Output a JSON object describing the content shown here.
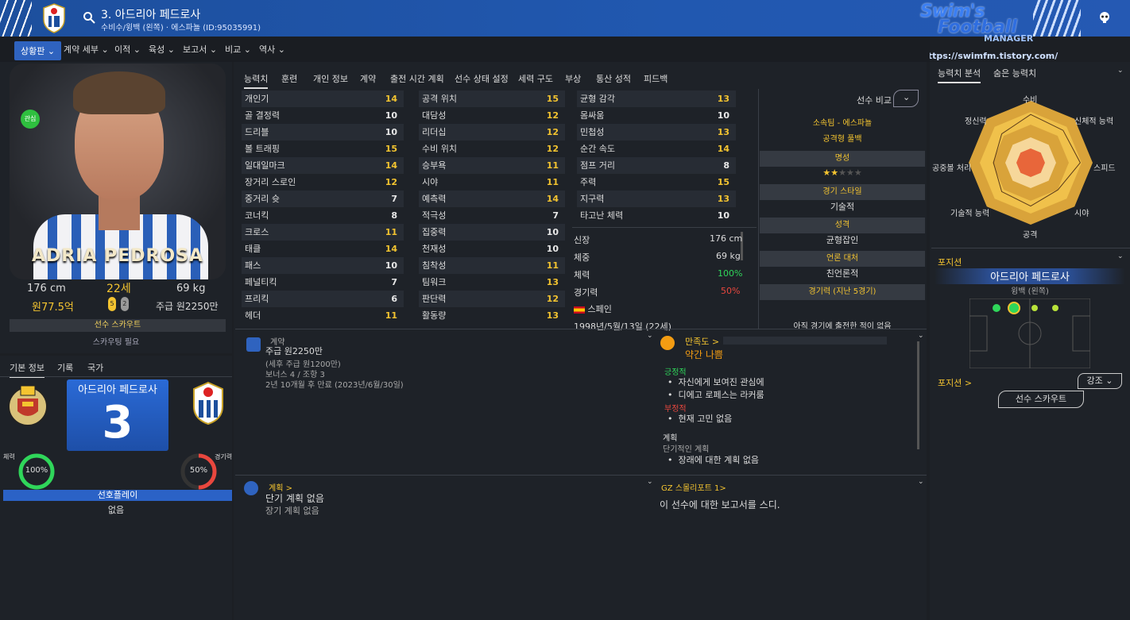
{
  "header": {
    "player_title": "3. 아드리아 페드로사",
    "player_sub": "수비수/윙백 (왼쪽) · 에스파뇰 (ID:95035991)"
  },
  "brand": {
    "line1": "Swim's",
    "line2": "Football",
    "line3": "MANAGER",
    "url": "https://swimfm.tistory.com/"
  },
  "nav": {
    "items": [
      "상황판",
      "계약 세부",
      "이적",
      "육성",
      "보고서",
      "비교",
      "역사"
    ]
  },
  "left": {
    "shirt_name": "ADRIA PEDROSA",
    "ready_badge": "관심",
    "height": "176 cm",
    "age": "22세",
    "weight": "69 kg",
    "value": "원77.5억",
    "foot_left": "5",
    "foot_right": "2",
    "wage": "주급 원2250만",
    "scout_label": "선수 스카우트",
    "scout_need": "스카우팅 필요"
  },
  "left_bottom": {
    "tabs": [
      "기본 정보",
      "기록",
      "국가"
    ],
    "card_name": "아드리아 페드로사",
    "number": "3",
    "fitness_label": "체력",
    "fitness_val": "100%",
    "condition_label": "경기력",
    "condition_val": "50%",
    "pref_label": "선호플레이",
    "pref_val": "없음"
  },
  "mid": {
    "tabs": [
      "능력치",
      "훈련",
      "개인 정보",
      "계약",
      "출전 시간 계획",
      "선수 상태 설정",
      "세력 구도",
      "부상",
      "통산 성적",
      "피드백"
    ],
    "col1": [
      [
        "개인기",
        "14"
      ],
      [
        "골 결정력",
        "10"
      ],
      [
        "드리블",
        "10"
      ],
      [
        "볼 트래핑",
        "15"
      ],
      [
        "일대일마크",
        "14"
      ],
      [
        "장거리 스로인",
        "12"
      ],
      [
        "중거리 슛",
        "7"
      ],
      [
        "코너킥",
        "8"
      ],
      [
        "크로스",
        "11"
      ],
      [
        "태클",
        "14"
      ],
      [
        "패스",
        "10"
      ],
      [
        "페널티킥",
        "7"
      ],
      [
        "프리킥",
        "6"
      ],
      [
        "헤더",
        "11"
      ]
    ],
    "col2": [
      [
        "공격 위치",
        "15"
      ],
      [
        "대담성",
        "12"
      ],
      [
        "리더십",
        "12"
      ],
      [
        "수비 위치",
        "12"
      ],
      [
        "승부욕",
        "11"
      ],
      [
        "시야",
        "11"
      ],
      [
        "예측력",
        "14"
      ],
      [
        "적극성",
        "7"
      ],
      [
        "집중력",
        "10"
      ],
      [
        "천재성",
        "10"
      ],
      [
        "침착성",
        "11"
      ],
      [
        "팀워크",
        "13"
      ],
      [
        "판단력",
        "12"
      ],
      [
        "활동량",
        "13"
      ]
    ],
    "col3": [
      [
        "균형 감각",
        "13"
      ],
      [
        "몸싸움",
        "10"
      ],
      [
        "민첩성",
        "13"
      ],
      [
        "순간 속도",
        "14"
      ],
      [
        "점프 거리",
        "8"
      ],
      [
        "주력",
        "15"
      ],
      [
        "지구력",
        "13"
      ],
      [
        "타고난 체력",
        "10"
      ]
    ],
    "phys": {
      "height_l": "신장",
      "height_v": "176 cm",
      "weight_l": "체중",
      "weight_v": "69 kg",
      "fit_l": "체력",
      "fit_v": "100%",
      "cond_l": "경기력",
      "cond_v": "50%",
      "nation": "스페인",
      "dob": "1998년/5월/13일 (22세)"
    },
    "info": {
      "compare": "선수 비교",
      "club": "소속팀 - 에스파뇰",
      "role": "공격형 풀백",
      "rep_h": "명성",
      "style_h": "경기 스타일",
      "style_v": "기술적",
      "pers_h": "성격",
      "pers_v": "균형잡인",
      "media_h": "언론 대처",
      "media_v": "친언론적",
      "form_h": "경기력 (지난 5경기)",
      "form_v": "아직 경기에 출전한 적이 없음"
    },
    "contract": {
      "h": "계약",
      "wage": "주급 원2250만",
      "tax": "(세후 주급 원1200만)",
      "bonus": "보너스 4 / 조항 3",
      "expiry": "2년 10개월 후 만료 (2023년/6월/30일)"
    },
    "satisfaction": {
      "h": "만족도 >",
      "v": "약간 나쁨",
      "pos_h": "긍정적",
      "pos1": "자신에게 보여진 관심에",
      "pos2": "디에고 로페스는 라커룸",
      "neg_h": "부정적",
      "neg1": "현재 고민 없음",
      "plan_h": "계획",
      "plan_sub": "단기적인 계획",
      "plan1": "장래에 대한 계획 없음"
    },
    "plans": {
      "h": "계획 >",
      "short": "단기 계획 없음",
      "long": "장기 계획 없음"
    },
    "report": {
      "h": "GZ 스몰리포트 1>",
      "v": "이 선수에 대한 보고서를 스디."
    }
  },
  "right": {
    "tabs": [
      "능력치 분석",
      "숨은 능력치"
    ],
    "radar": [
      "수비",
      "신체적 능력",
      "스피드",
      "시야",
      "공격",
      "기술적 능력",
      "공중볼 처리",
      "정신력"
    ],
    "pos_h": "포지션",
    "pos_name": "아드리아 페드로사",
    "pos_sub": "윙백 (왼쪽)",
    "pos_link": "포지션 >",
    "strong": "강조",
    "scout_btn": "선수 스카우트"
  },
  "colors": {
    "accent": "#2f63bf",
    "gold": "#f4c430",
    "panel": "#1e2228"
  }
}
